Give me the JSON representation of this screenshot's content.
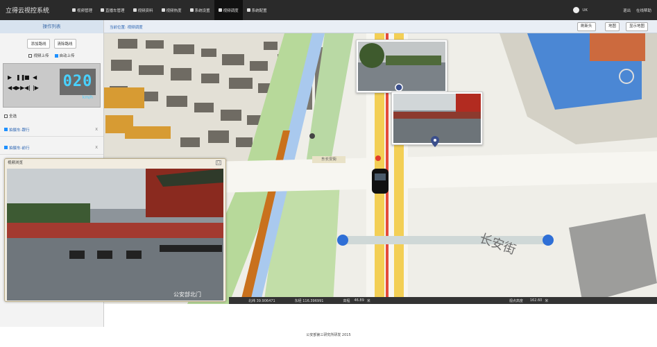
{
  "app": {
    "title": "立得云视控系统"
  },
  "nav": {
    "items": [
      {
        "label": "视频管理"
      },
      {
        "label": "直播车管理"
      },
      {
        "label": "视频资料"
      },
      {
        "label": "视频热度"
      },
      {
        "label": "系统设置"
      },
      {
        "label": "视频调度"
      },
      {
        "label": "系统配置"
      }
    ],
    "active_index": 5
  },
  "user": {
    "name": "UK",
    "logout_label": "退出",
    "help_label": "在线帮助"
  },
  "left_panel": {
    "title": "操作列表",
    "add_route_label": "添加路线",
    "clear_route_label": "清除路线",
    "video_upload_label": "视频上传",
    "auto_upload_label": "自动上传",
    "speed_value": "020",
    "speed_unit": "km/h",
    "select_all_label": "全选",
    "vehicles": [
      {
        "label": "拍摄车-跟行",
        "close": "X"
      },
      {
        "label": "拍摄车-前行",
        "close": "X"
      }
    ]
  },
  "breadcrumb": {
    "text": "当前位置: 视频调度"
  },
  "map_toolbar": {
    "zoom_btn": "刷新头",
    "layer_btn": "地图",
    "show_btn": "显示地图"
  },
  "map": {
    "road_label": "东长安街"
  },
  "video_window": {
    "title": "视频浏览",
    "close": "□",
    "caption": "公安部北门"
  },
  "status_bar": {
    "lon": "北纬 39.906471",
    "lat": "东经 116.396991",
    "height": "高程",
    "height_val": "46.89",
    "height_unit": "米",
    "view": "视点高度",
    "view_val": "162.60",
    "view_unit": "米"
  },
  "footer": {
    "text": "公安部第三研究所研发 2015"
  }
}
